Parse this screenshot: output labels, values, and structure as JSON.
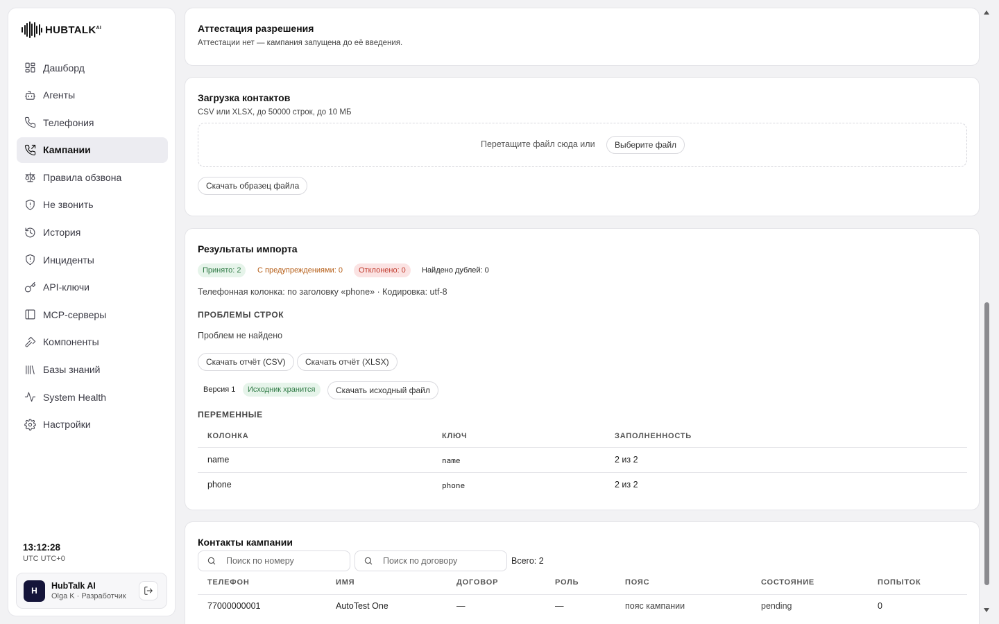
{
  "brand": {
    "name": "HUBTALK",
    "sup": "AI"
  },
  "nav": [
    {
      "label": "Дашборд",
      "icon": "dashboard-icon"
    },
    {
      "label": "Агенты",
      "icon": "bot-icon"
    },
    {
      "label": "Телефония",
      "icon": "phone-icon"
    },
    {
      "label": "Кампании",
      "icon": "phone-outgoing-icon",
      "active": true
    },
    {
      "label": "Правила обзвона",
      "icon": "scale-icon"
    },
    {
      "label": "Не звонить",
      "icon": "shield-icon"
    },
    {
      "label": "История",
      "icon": "history-icon"
    },
    {
      "label": "Инциденты",
      "icon": "shield-alert-icon"
    },
    {
      "label": "API-ключи",
      "icon": "key-icon"
    },
    {
      "label": "MCP-серверы",
      "icon": "panel-icon"
    },
    {
      "label": "Компоненты",
      "icon": "hammer-icon"
    },
    {
      "label": "Базы знаний",
      "icon": "library-icon"
    },
    {
      "label": "System Health",
      "icon": "activity-icon"
    },
    {
      "label": "Настройки",
      "icon": "gear-icon"
    }
  ],
  "clock": {
    "time": "13:12:28",
    "tz": "UTC UTC+0"
  },
  "user": {
    "initial": "H",
    "name": "HubTalk AI",
    "role": "Olga K · Разработчик"
  },
  "attestation": {
    "title": "Аттестация разрешения",
    "text": "Аттестации нет — кампания запущена до её введения."
  },
  "upload": {
    "title": "Загрузка контактов",
    "subtitle": "CSV или XLSX, до 50000 строк, до 10 МБ",
    "drop_text": "Перетащите файл сюда или",
    "choose_label": "Выберите файл",
    "sample_label": "Скачать образец файла"
  },
  "import": {
    "title": "Результаты импорта",
    "badges": {
      "accepted": "Принято: 2",
      "warnings": "С предупреждениями: 0",
      "rejected": "Отклонено: 0",
      "duplicates": "Найдено дублей: 0"
    },
    "phone_column_info": "Телефонная колонка: по заголовку «phone» · Кодировка: utf-8",
    "problems_heading": "ПРОБЛЕМЫ СТРОК",
    "problems_text": "Проблем не найдено",
    "report_csv": "Скачать отчёт (CSV)",
    "report_xlsx": "Скачать отчёт (XLSX)",
    "version_label": "Версия 1",
    "source_badge": "Исходник хранится",
    "download_source": "Скачать исходный файл",
    "vars_heading": "ПЕРЕМЕННЫЕ",
    "vars_columns": [
      "КОЛОНКА",
      "КЛЮЧ",
      "ЗАПОЛНЕННОСТЬ"
    ],
    "vars_rows": [
      {
        "column": "name",
        "key": "name",
        "fill": "2 из 2"
      },
      {
        "column": "phone",
        "key": "phone",
        "fill": "2 из 2"
      }
    ]
  },
  "contacts": {
    "title": "Контакты кампании",
    "search_phone_placeholder": "Поиск по номеру",
    "search_contract_placeholder": "Поиск по договору",
    "total": "Всего: 2",
    "columns": [
      "ТЕЛЕФОН",
      "ИМЯ",
      "ДОГОВОР",
      "РОЛЬ",
      "ПОЯС",
      "СОСТОЯНИЕ",
      "ПОПЫТОК"
    ],
    "rows": [
      {
        "phone": "77000000001",
        "name": "AutoTest One",
        "contract": "—",
        "role": "—",
        "zone": "пояс кампании",
        "state": "pending",
        "attempts": "0"
      }
    ]
  },
  "colors": {
    "accepted_bg": "#e6f4ea",
    "accepted_fg": "#2f7a45",
    "warnings_fg": "#b55d16",
    "rejected_bg": "#fbe3e3",
    "rejected_fg": "#c0392b",
    "avatar_bg": "#15153a"
  }
}
